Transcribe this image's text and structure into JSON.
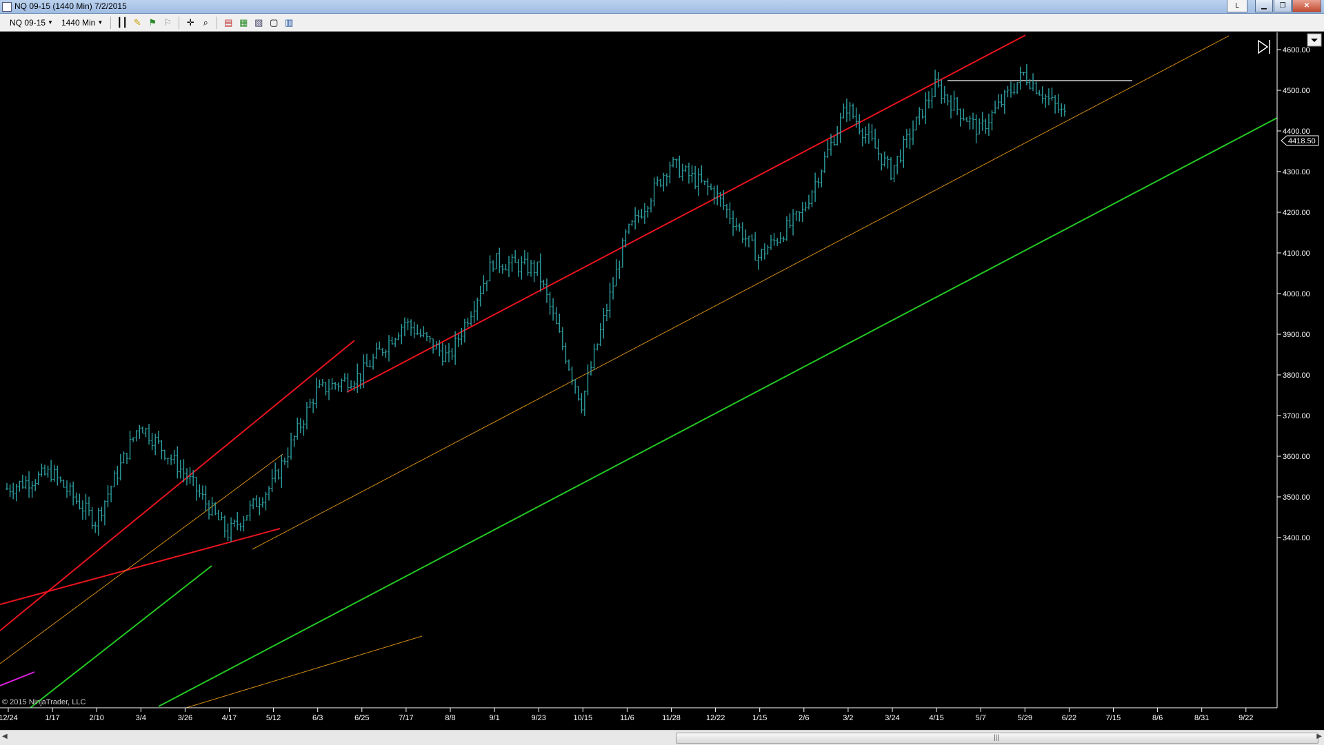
{
  "window": {
    "title": "NQ 09-15 (1440 Min)  7/2/2015",
    "layout_btn": "L"
  },
  "toolbar": {
    "instrument": "NQ 09-15",
    "interval": "1440 Min"
  },
  "chart": {
    "copyright": "© 2015 NinjaTrader, LLC",
    "last_price_label": "4418.50",
    "price_ticks": [
      "4600.00",
      "4500.00",
      "4400.00",
      "4300.00",
      "4200.00",
      "4100.00",
      "4000.00",
      "3900.00",
      "3800.00",
      "3700.00",
      "3600.00",
      "3500.00",
      "3400.00"
    ],
    "date_ticks": [
      "12/24",
      "1/17",
      "2/10",
      "3/4",
      "3/26",
      "4/17",
      "5/12",
      "6/3",
      "6/25",
      "7/17",
      "8/8",
      "9/1",
      "9/23",
      "10/15",
      "11/6",
      "11/28",
      "12/22",
      "1/15",
      "2/6",
      "3/2",
      "3/24",
      "4/15",
      "5/7",
      "5/29",
      "6/22",
      "7/15",
      "8/6",
      "8/31",
      "9/22"
    ],
    "colors": {
      "bars": "#2e9ea0",
      "red_line": "#e8141e",
      "green_line": "#23c823",
      "orange_line": "#d28c14",
      "magenta_line": "#e020e0"
    }
  },
  "chart_data": {
    "type": "ohlc",
    "ylim": [
      3310,
      4630
    ],
    "x": [
      "12/24",
      "1/17",
      "2/10",
      "3/4",
      "3/26",
      "4/17",
      "5/12",
      "6/3",
      "6/25",
      "7/17",
      "8/8",
      "9/1",
      "9/23",
      "10/15",
      "11/6",
      "11/28",
      "12/22",
      "1/15",
      "2/6",
      "3/2",
      "3/24",
      "4/15",
      "5/7",
      "5/29",
      "6/22"
    ],
    "close": [
      3520,
      3560,
      3440,
      3680,
      3560,
      3410,
      3530,
      3760,
      3800,
      3930,
      3840,
      4080,
      4060,
      3730,
      4140,
      4320,
      4250,
      4090,
      4200,
      4460,
      4300,
      4510,
      4400,
      4540,
      4430
    ]
  }
}
